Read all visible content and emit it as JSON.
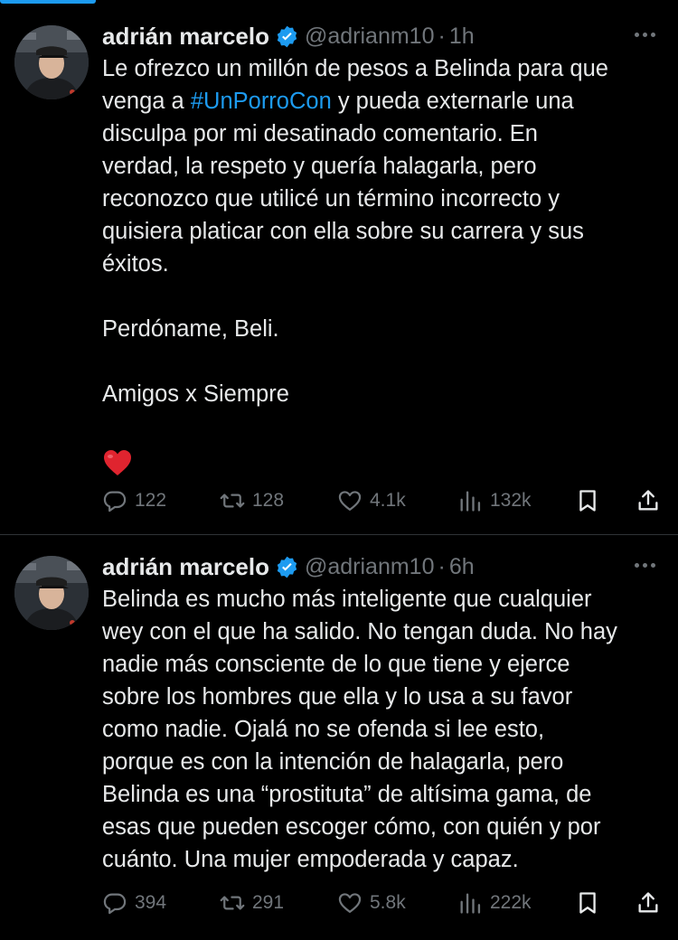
{
  "tweets": [
    {
      "author": {
        "name": "adrián marcelo",
        "handle": "@adrianm10",
        "time": "1h",
        "verified": true
      },
      "text_lines_pre": [
        "Le ofrezco un millón de pesos a Belinda para que"
      ],
      "hashtag_line": {
        "pre": "venga a ",
        "hashtag": "#UnPorroCon",
        "post": " y pueda externarle una"
      },
      "text_lines_post": [
        "disculpa por mi desatinado comentario. En",
        "verdad, la respeto y quería halagarla, pero",
        "reconozco que utilicé un término incorrecto y",
        "quisiera platicar con ella sobre su carrera y sus",
        "éxitos."
      ],
      "paragraph_2": "Perdóname, Beli.",
      "paragraph_3": "Amigos x Siempre",
      "emoji": "red-heart",
      "stats": {
        "replies": "122",
        "retweets": "128",
        "likes": "4.1k",
        "views": "132k"
      }
    },
    {
      "author": {
        "name": "adrián marcelo",
        "handle": "@adrianm10",
        "time": "6h",
        "verified": true
      },
      "text_lines": [
        "Belinda es mucho más inteligente que cualquier",
        "wey con el que ha salido. No tengan duda. No hay",
        "nadie más consciente de lo que tiene y ejerce",
        "sobre los hombres que ella y lo usa a su favor",
        "como nadie. Ojalá no se ofenda si lee esto,",
        "porque es con la intención de halagarla, pero",
        "Belinda es una “prostituta” de altísima gama, de",
        "esas que pueden escoger cómo, con quién y por",
        "cuánto. Una mujer empoderada y capaz."
      ],
      "stats": {
        "replies": "394",
        "retweets": "291",
        "likes": "5.8k",
        "views": "222k"
      }
    }
  ],
  "separator": "·",
  "colors": {
    "background": "#000000",
    "text": "#e7e9ea",
    "muted": "#71767b",
    "accent": "#1d9bf0",
    "divider": "#2f3336"
  }
}
